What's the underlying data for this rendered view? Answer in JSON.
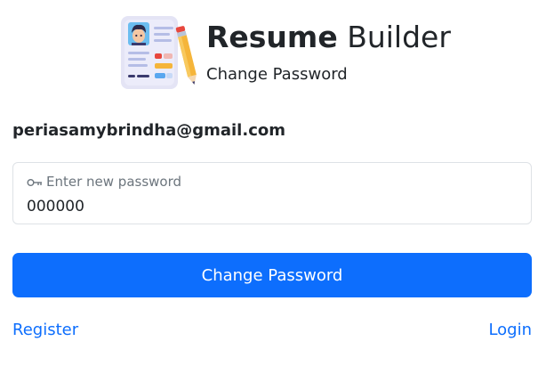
{
  "header": {
    "title_bold": "Resume",
    "title_rest": "Builder",
    "subtitle": "Change Password",
    "logo_icon": "resume-document-pencil-icon"
  },
  "account": {
    "email": "periasamybrindha@gmail.com"
  },
  "password_field": {
    "label": "Enter new password",
    "value": "000000",
    "label_icon": "key-icon"
  },
  "actions": {
    "submit_label": "Change Password"
  },
  "links": {
    "register": "Register",
    "login": "Login"
  },
  "colors": {
    "primary": "#0d6efd",
    "text": "#212529",
    "muted": "#6c757d",
    "border": "#dee2e6"
  }
}
